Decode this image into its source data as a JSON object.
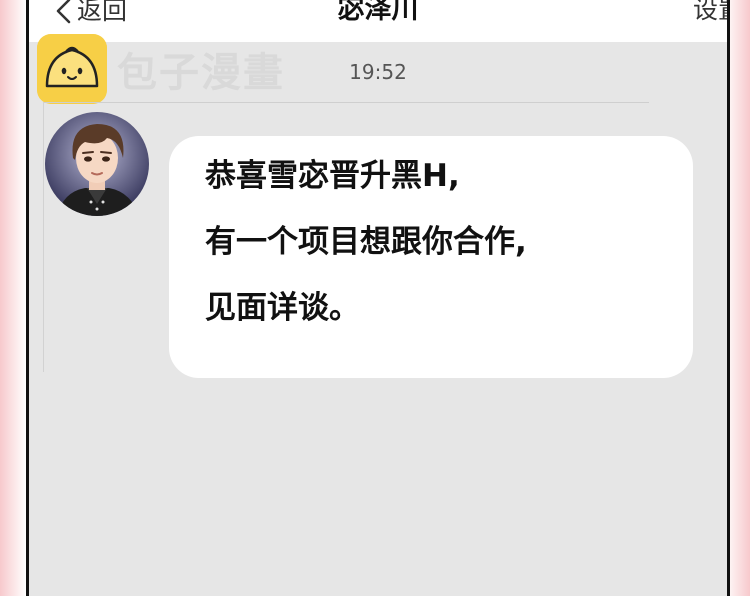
{
  "nav": {
    "back_label": "返回",
    "title": "宓泽川",
    "settings_label": "设置"
  },
  "watermark": {
    "text": "包子漫畫"
  },
  "chat": {
    "timestamp": "19:52",
    "message_lines": [
      "恭喜雪宓晋升黑H,",
      "有一个项目想跟你合作,",
      "见面详谈。"
    ]
  },
  "colors": {
    "chat_background": "#e6e6e6",
    "bubble": "#ffffff",
    "logo_yellow": "#f7cf46",
    "frame_pink": "#f7c9cc"
  },
  "icons": {
    "back": "chevron-left-icon",
    "logo": "baozi-logo-icon"
  }
}
